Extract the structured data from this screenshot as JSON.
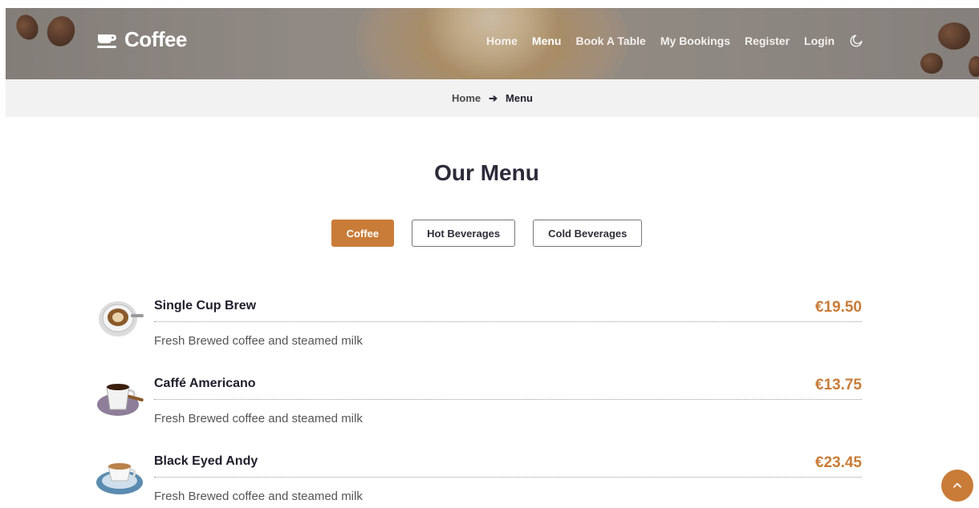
{
  "brand": {
    "name": "Coffee",
    "icon": "coffee-cup-icon"
  },
  "nav": {
    "items": [
      {
        "label": "Home",
        "active": false
      },
      {
        "label": "Menu",
        "active": true
      },
      {
        "label": "Book A Table",
        "active": false
      },
      {
        "label": "My Bookings",
        "active": false
      },
      {
        "label": "Register",
        "active": false
      },
      {
        "label": "Login",
        "active": false
      }
    ],
    "theme_toggle_icon": "moon-icon"
  },
  "breadcrumb": {
    "home": "Home",
    "separator_icon": "arrow-right-icon",
    "current": "Menu"
  },
  "menu": {
    "title": "Our Menu",
    "tabs": [
      {
        "label": "Coffee",
        "active": true
      },
      {
        "label": "Hot Beverages",
        "active": false
      },
      {
        "label": "Cold Beverages",
        "active": false
      }
    ],
    "items": [
      {
        "name": "Single Cup Brew",
        "price": "€19.50",
        "description": "Fresh Brewed coffee and steamed milk"
      },
      {
        "name": "Caffé Americano",
        "price": "€13.75",
        "description": "Fresh Brewed coffee and steamed milk"
      },
      {
        "name": "Black Eyed Andy",
        "price": "€23.45",
        "description": "Fresh Brewed coffee and steamed milk"
      }
    ]
  },
  "scroll_top_icon": "chevron-up-icon",
  "colors": {
    "accent": "#c97c38",
    "breadcrumb_bg": "#f2f2f2",
    "text_dark": "#2b2b3a"
  }
}
